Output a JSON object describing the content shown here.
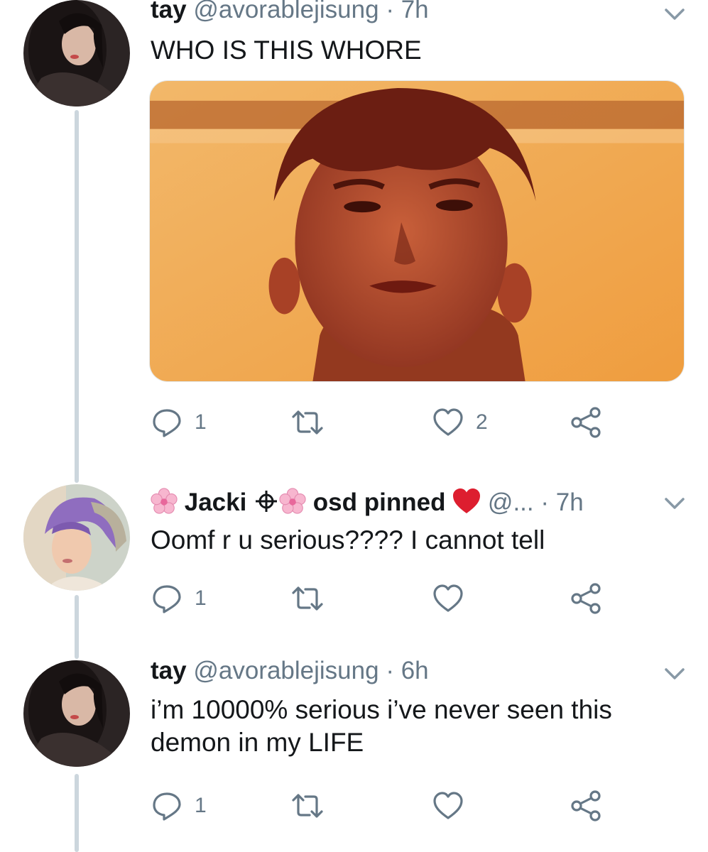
{
  "tweets": [
    {
      "name": "tay",
      "handle": "@avorablejisung",
      "separator": "·",
      "time": "7h",
      "text": "WHO IS THIS WHORE",
      "has_media": true,
      "actions": {
        "reply_count": "1",
        "retweet_count": "",
        "like_count": "2"
      }
    },
    {
      "name_prefix_emoji": "cherry-blossom-icon",
      "name_part1": "Jacki",
      "name_symbol": "⚘-glyph",
      "name_part2": "osd pinned",
      "name_suffix_emoji": "red-heart-icon",
      "handle": "@...",
      "separator": "·",
      "time": "7h",
      "text": "Oomf r u serious???? I cannot tell",
      "has_media": false,
      "actions": {
        "reply_count": "1",
        "retweet_count": "",
        "like_count": ""
      }
    },
    {
      "name": "tay",
      "handle": "@avorablejisung",
      "separator": "·",
      "time": "6h",
      "text_line1": "i’m 10000% serious i’ve never seen this",
      "text_line2": "demon in my LIFE",
      "has_media": false,
      "actions": {
        "reply_count": "1",
        "retweet_count": "",
        "like_count": ""
      }
    }
  ],
  "colors": {
    "text_primary": "#14171a",
    "text_secondary": "#657786",
    "thread_line": "#ccd6dd",
    "heart": "#e0245e"
  },
  "icons": [
    "reply-icon",
    "retweet-icon",
    "like-icon",
    "share-icon",
    "caret-down-icon"
  ]
}
